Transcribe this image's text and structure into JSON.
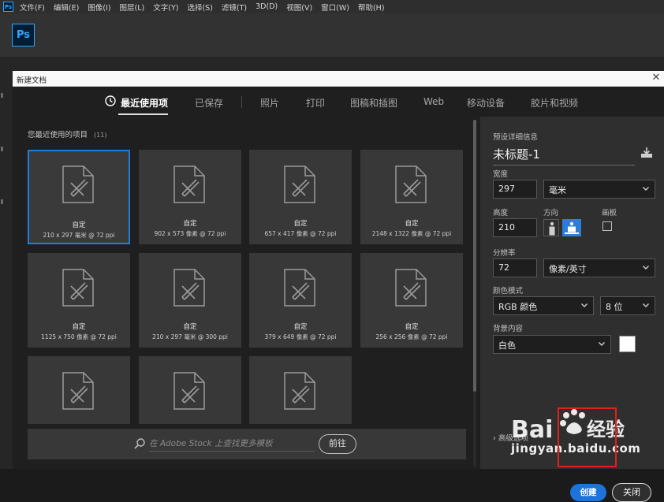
{
  "menubar": {
    "items": [
      "文件(F)",
      "编辑(E)",
      "图像(I)",
      "图层(L)",
      "文字(Y)",
      "选择(S)",
      "滤镜(T)",
      "3D(D)",
      "视图(V)",
      "窗口(W)",
      "帮助(H)"
    ]
  },
  "app": {
    "logo": "Ps"
  },
  "dialog": {
    "title": "新建文档",
    "tabs": [
      "最近使用项",
      "已保存",
      "照片",
      "打印",
      "图稿和插图",
      "Web",
      "移动设备",
      "胶片和视频"
    ],
    "active_tab": "最近使用项",
    "recent": {
      "heading": "您最近使用的项目",
      "count": "(11)",
      "items": [
        {
          "name": "自定",
          "dims": "210 x 297 毫米 @ 72 ppi"
        },
        {
          "name": "自定",
          "dims": "902 x 573 像素 @ 72 ppi"
        },
        {
          "name": "自定",
          "dims": "657 x 417 像素 @ 72 ppi"
        },
        {
          "name": "自定",
          "dims": "2148 x 1322 像素 @ 72 ppi"
        },
        {
          "name": "自定",
          "dims": "1125 x 750 像素 @ 72 ppi"
        },
        {
          "name": "自定",
          "dims": "210 x 297 毫米 @ 300 ppi"
        },
        {
          "name": "自定",
          "dims": "379 x 649 像素 @ 72 ppi"
        },
        {
          "name": "自定",
          "dims": "256 x 256 像素 @ 72 ppi"
        },
        {
          "name": "",
          "dims": ""
        },
        {
          "name": "",
          "dims": ""
        },
        {
          "name": "",
          "dims": ""
        }
      ]
    },
    "search": {
      "placeholder": "在 Adobe Stock 上查找更多模板",
      "go_label": "前往"
    },
    "details": {
      "heading": "预设详细信息",
      "doc_name": "未标题-1",
      "width_label": "宽度",
      "width_value": "297",
      "width_unit": "毫米",
      "height_label": "高度",
      "height_value": "210",
      "orientation_label": "方向",
      "artboard_label": "画板",
      "resolution_label": "分辨率",
      "resolution_value": "72",
      "resolution_unit": "像素/英寸",
      "color_mode_label": "颜色模式",
      "color_mode": "RGB 颜色",
      "bit_depth": "8 位",
      "background_label": "背景内容",
      "background": "白色",
      "background_color": "#ffffff",
      "advanced": "高级选项"
    },
    "buttons": {
      "create": "创建",
      "close": "关闭"
    }
  },
  "watermark": {
    "text": "jingyan.baidu.com"
  },
  "colors": {
    "accent": "#1c74da",
    "selected_border": "#1c7ee0",
    "highlight": "#e0201c"
  }
}
